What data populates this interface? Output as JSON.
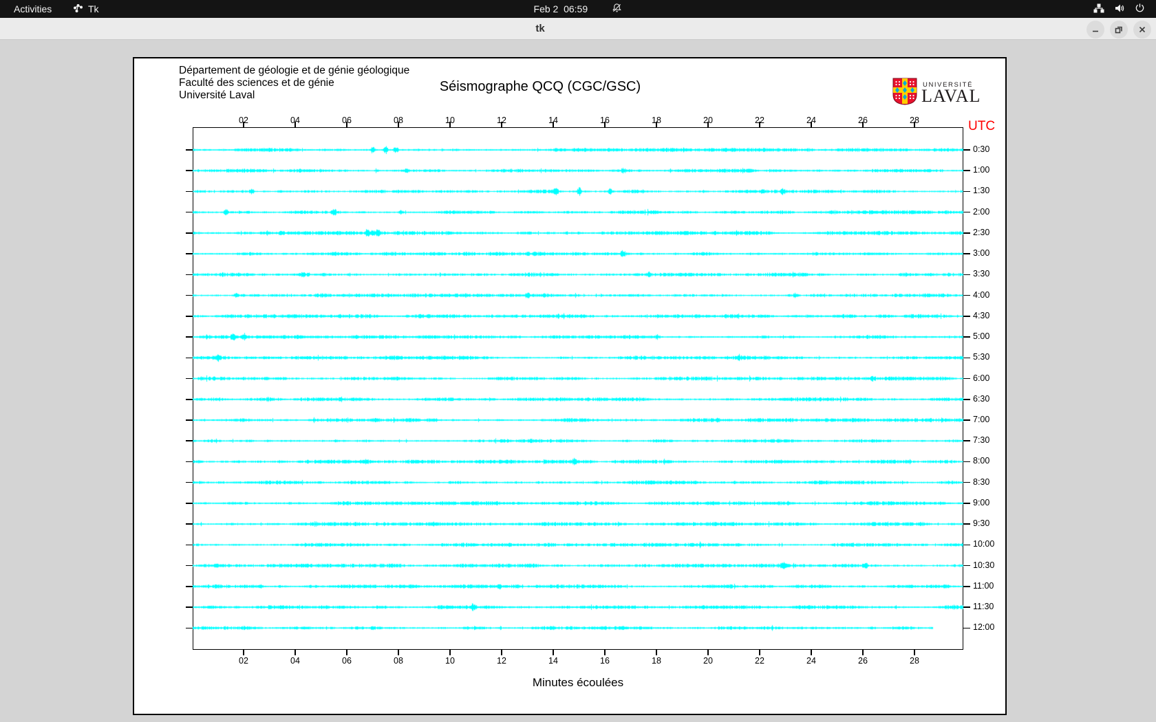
{
  "top_bar": {
    "activities_label": "Activities",
    "app_name": "Tk",
    "clock": "Feb 2  06:59",
    "icons": [
      "notifications-off-icon",
      "network-wired-icon",
      "volume-icon",
      "power-icon"
    ]
  },
  "title_bar": {
    "title": "tk",
    "buttons": [
      "minimize",
      "restore",
      "close"
    ]
  },
  "window": {
    "header_lines": [
      "Département de géologie et de génie géologique",
      "Faculté des sciences et de génie",
      "Université Laval"
    ],
    "title": "Séismographe QCQ (CGC/GSC)",
    "logo_text_line1": "UNIVERSITÉ",
    "logo_text_line2": "LAVAL",
    "utc_label": "UTC",
    "xlabel": "Minutes écoulées"
  },
  "chart_data": {
    "type": "line",
    "title": "Séismographe QCQ (CGC/GSC)",
    "xlabel": "Minutes écoulées",
    "y_axis_right_label": "UTC",
    "trace_color": "#00ffff",
    "x_axis": {
      "min_minute": 0,
      "max_minute": 29.8,
      "tick_minutes": [
        2,
        4,
        6,
        8,
        10,
        12,
        14,
        16,
        18,
        20,
        22,
        24,
        26,
        28
      ],
      "tick_labels": [
        "02",
        "04",
        "06",
        "08",
        "10",
        "12",
        "14",
        "16",
        "18",
        "20",
        "22",
        "24",
        "26",
        "28"
      ]
    },
    "rows": [
      {
        "utc": "0:30",
        "events": [
          {
            "m": 7.0,
            "a": 6
          },
          {
            "m": 7.5,
            "a": 7
          },
          {
            "m": 7.9,
            "a": 5
          }
        ]
      },
      {
        "utc": "1:00",
        "events": [
          {
            "m": 8.3,
            "a": 4
          },
          {
            "m": 16.7,
            "a": 3
          }
        ]
      },
      {
        "utc": "1:30",
        "events": [
          {
            "m": 2.3,
            "a": 5
          },
          {
            "m": 14.1,
            "a": 5
          },
          {
            "m": 15.0,
            "a": 6
          },
          {
            "m": 16.2,
            "a": 6
          },
          {
            "m": 22.1,
            "a": 4
          },
          {
            "m": 22.9,
            "a": 5
          }
        ]
      },
      {
        "utc": "2:00",
        "events": [
          {
            "m": 1.3,
            "a": 5
          },
          {
            "m": 5.5,
            "a": 4
          },
          {
            "m": 8.1,
            "a": 3
          }
        ]
      },
      {
        "utc": "2:30",
        "events": [
          {
            "m": 3.4,
            "a": 3
          },
          {
            "m": 6.8,
            "a": 6
          },
          {
            "m": 7.0,
            "a": 6
          },
          {
            "m": 7.2,
            "a": 5
          }
        ]
      },
      {
        "utc": "3:00",
        "events": [
          {
            "m": 16.7,
            "a": 5
          }
        ]
      },
      {
        "utc": "3:30",
        "events": [
          {
            "m": 4.3,
            "a": 3
          },
          {
            "m": 4.5,
            "a": 3
          },
          {
            "m": 17.7,
            "a": 3
          }
        ]
      },
      {
        "utc": "4:00",
        "events": [
          {
            "m": 1.7,
            "a": 5
          },
          {
            "m": 13.0,
            "a": 4
          },
          {
            "m": 23.4,
            "a": 3
          }
        ]
      },
      {
        "utc": "4:30",
        "events": []
      },
      {
        "utc": "5:00",
        "events": [
          {
            "m": 1.6,
            "a": 6
          },
          {
            "m": 2.0,
            "a": 5
          },
          {
            "m": 18.0,
            "a": 4
          }
        ]
      },
      {
        "utc": "5:30",
        "events": [
          {
            "m": 1.0,
            "a": 4
          },
          {
            "m": 21.2,
            "a": 3
          }
        ]
      },
      {
        "utc": "6:00",
        "events": [
          {
            "m": 26.4,
            "a": 4
          }
        ]
      },
      {
        "utc": "6:30",
        "events": []
      },
      {
        "utc": "7:00",
        "events": []
      },
      {
        "utc": "7:30",
        "events": []
      },
      {
        "utc": "8:00",
        "events": [
          {
            "m": 14.8,
            "a": 4
          }
        ]
      },
      {
        "utc": "8:30",
        "events": []
      },
      {
        "utc": "9:00",
        "events": []
      },
      {
        "utc": "9:30",
        "events": []
      },
      {
        "utc": "10:00",
        "events": []
      },
      {
        "utc": "10:30",
        "events": [
          {
            "m": 22.9,
            "a": 4
          },
          {
            "m": 26.1,
            "a": 4
          }
        ]
      },
      {
        "utc": "11:00",
        "events": [
          {
            "m": 11.9,
            "a": 5
          }
        ]
      },
      {
        "utc": "11:30",
        "events": [
          {
            "m": 10.9,
            "a": 5
          }
        ]
      },
      {
        "utc": "12:00",
        "events": [
          {
            "m": 7.0,
            "a": 2
          }
        ]
      }
    ],
    "last_row_end_minute": 28.7
  }
}
